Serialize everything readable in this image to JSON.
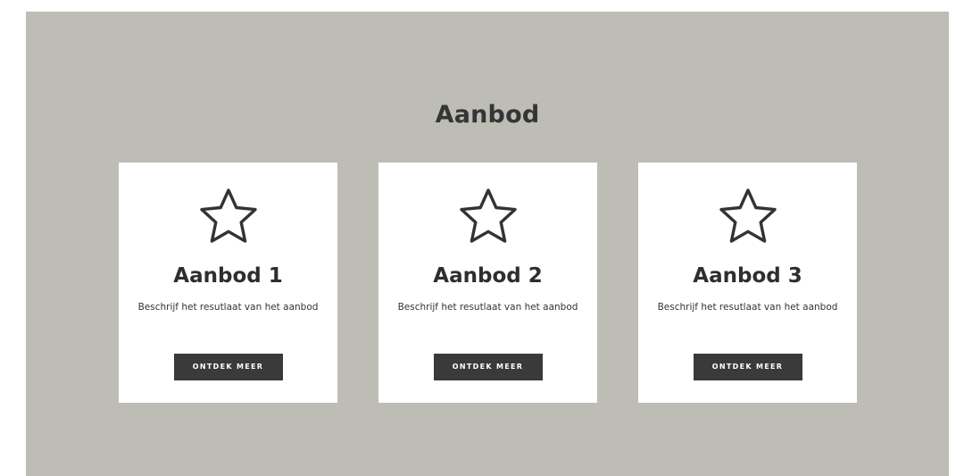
{
  "section": {
    "title": "Aanbod",
    "background_color": "#bdbdb6"
  },
  "cards": [
    {
      "icon": "star-outline-icon",
      "title": "Aanbod 1",
      "description": "Beschrijf het resutlaat van het aanbod",
      "button_label": "ONTDEK MEER"
    },
    {
      "icon": "star-outline-icon",
      "title": "Aanbod 2",
      "description": "Beschrijf het resutlaat van het aanbod",
      "button_label": "ONTDEK MEER"
    },
    {
      "icon": "star-outline-icon",
      "title": "Aanbod 3",
      "description": "Beschrijf het resutlaat van het aanbod",
      "button_label": "ONTDEK MEER"
    }
  ],
  "colors": {
    "card_background": "#ffffff",
    "text": "#333333",
    "button_background": "#3a3a3a",
    "button_text": "#ffffff"
  }
}
